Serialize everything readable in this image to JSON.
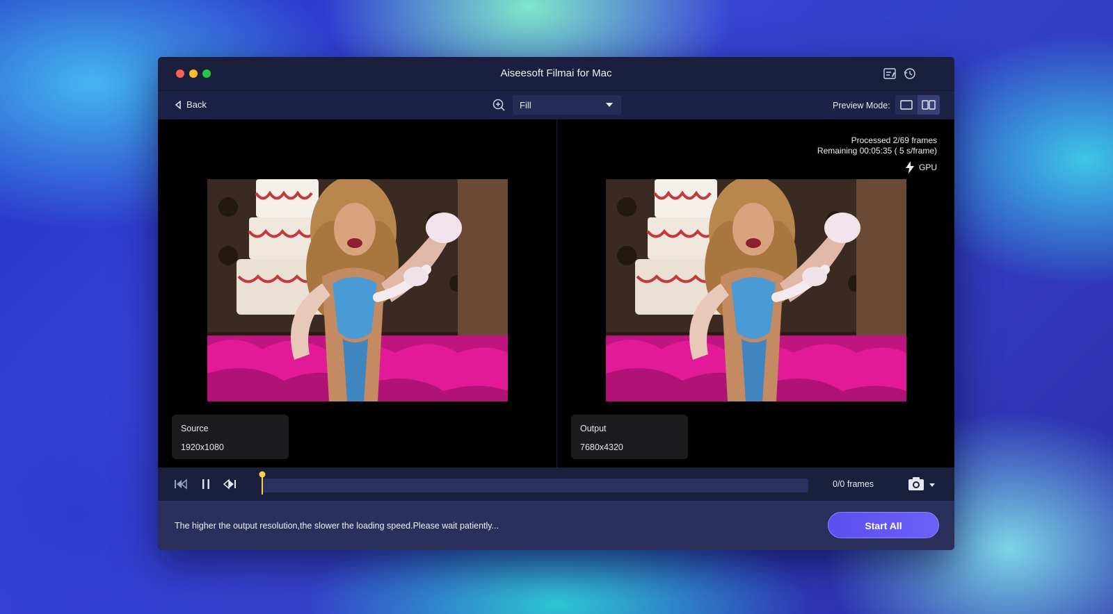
{
  "window": {
    "title": "Aiseesoft Filmai for Mac"
  },
  "toolbar": {
    "back_label": "Back",
    "zoom_mode": "Fill",
    "preview_mode_label": "Preview Mode:"
  },
  "source": {
    "label": "Source",
    "resolution": "1920x1080"
  },
  "output": {
    "label": "Output",
    "resolution": "7680x4320",
    "processed": "Processed 2/69 frames",
    "remaining": "Remaining 00:05:35 ( 5 s/frame)",
    "gpu_label": "GPU"
  },
  "playback": {
    "frames": "0/0 frames",
    "progress": 0.0
  },
  "footer": {
    "hint": "The higher the output resolution,the slower the loading speed.Please wait patiently...",
    "start_label": "Start All"
  },
  "colors": {
    "accent": "#5a4ff0",
    "titlebar": "#1a1f3e",
    "footer": "#2b2f5c",
    "playhead": "#f2d24a"
  },
  "icons": [
    "list-icon",
    "history-icon",
    "back-arrow-icon",
    "zoom-in-icon",
    "single-view-icon",
    "split-view-icon",
    "lightning-icon",
    "previous-frame-icon",
    "pause-icon",
    "next-frame-icon",
    "camera-icon"
  ]
}
